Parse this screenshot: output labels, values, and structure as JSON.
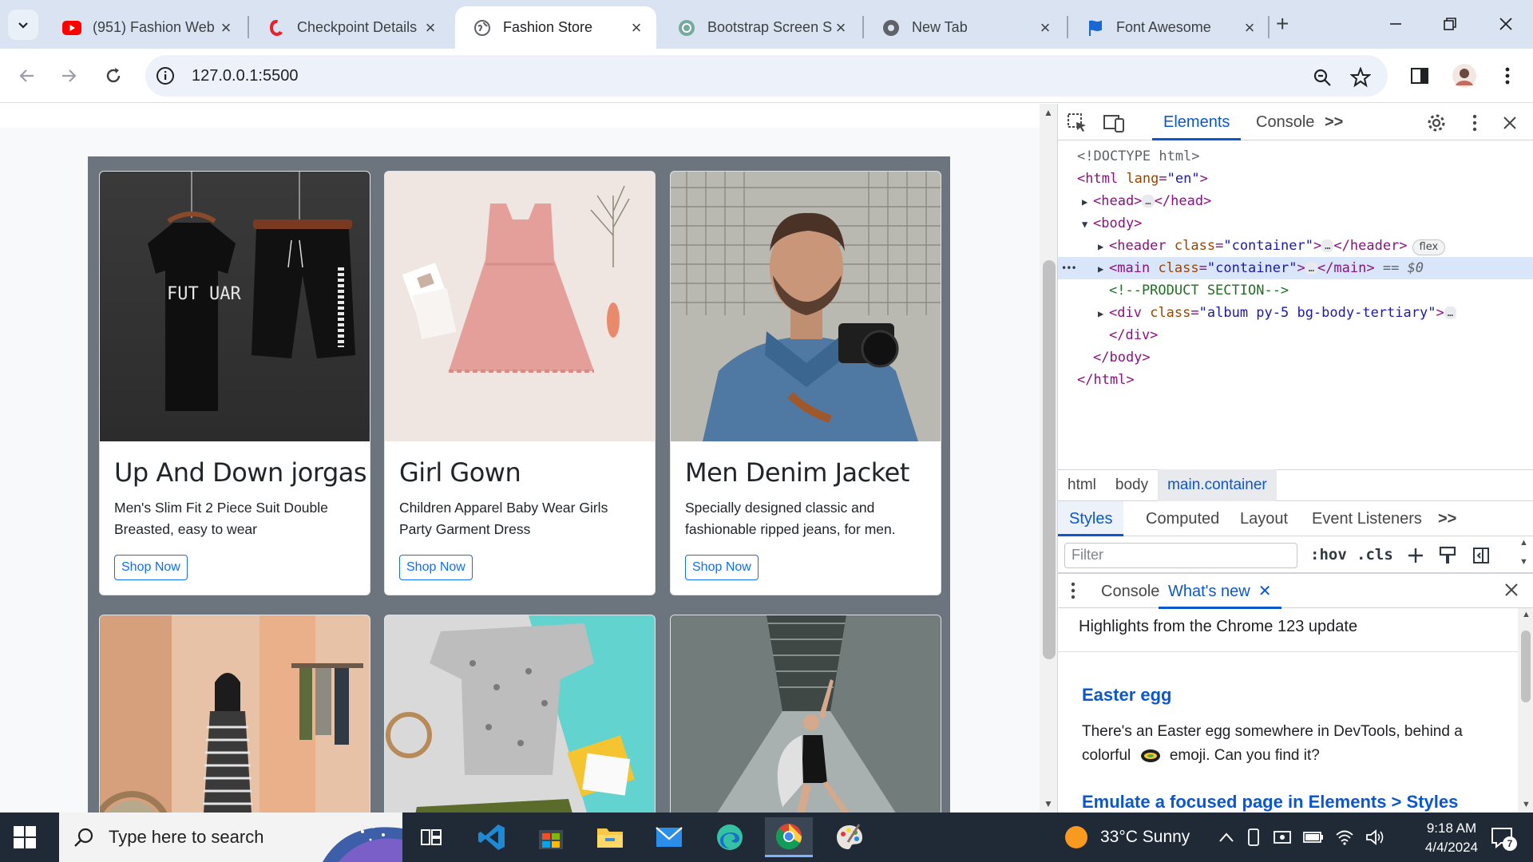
{
  "browser": {
    "tabs": [
      {
        "title": "(951) Fashion Web",
        "icon": "youtube-icon",
        "active": false
      },
      {
        "title": "Checkpoint Details",
        "icon": "checkpoint-icon",
        "active": false
      },
      {
        "title": "Fashion Store",
        "icon": "globe-icon",
        "active": true
      },
      {
        "title": "Bootstrap Screen S",
        "icon": "chatgpt-icon",
        "active": false
      },
      {
        "title": "New Tab",
        "icon": "chrome-icon",
        "active": false
      },
      {
        "title": "Font Awesome",
        "icon": "font-awesome-flag-icon",
        "active": false
      }
    ],
    "new_tab_label": "+",
    "url": "127.0.0.1:5500",
    "colors": {
      "tabstrip": "#dae3f1",
      "omnibox": "#edf2fa"
    }
  },
  "page": {
    "cards": [
      {
        "title": "Up And Down jorgas",
        "description": "Men's Slim Fit 2 Piece Suit Double Breasted, easy to wear",
        "button": "Shop Now",
        "image": "tshirt-shorts-image"
      },
      {
        "title": "Girl Gown",
        "description": "Children Apparel Baby Wear Girls Party Garment Dress",
        "button": "Shop Now",
        "image": "pink-dress-image"
      },
      {
        "title": "Men Denim Jacket",
        "description": "Specially designed classic and fashionable ripped jeans, for men.",
        "button": "Shop Now",
        "image": "man-camera-image"
      },
      {
        "title": "",
        "description": "",
        "button": "",
        "image": "woman-striped-dress-image"
      },
      {
        "title": "",
        "description": "",
        "button": "",
        "image": "baby-clothes-flatlay-image"
      },
      {
        "title": "",
        "description": "",
        "button": "",
        "image": "dancer-corridor-image"
      }
    ],
    "print_on_shirt": "FUT UAR",
    "colors": {
      "album_bg": "#6c757d",
      "button": "#0d6efd"
    }
  },
  "devtools": {
    "tabs": [
      "Elements",
      "Console"
    ],
    "more_tabs": ">>",
    "dom": {
      "doctype": "<!DOCTYPE html>",
      "html_open_tag": "<html",
      "html_attr": "lang",
      "html_val": "\"en\"",
      "head_open": "<head>",
      "head_close": "</head>",
      "body_open": "<body>",
      "header_open": "<header",
      "header_attr": "class",
      "header_val": "\"container\"",
      "header_close": "</header>",
      "flex_badge": "flex",
      "main_open": "<main",
      "main_attr": "class",
      "main_val": "\"container\"",
      "main_close": "</main>",
      "main_eq": "== $0",
      "comment": "<!--PRODUCT SECTION-->",
      "div_open": "<div",
      "div_attr": "class",
      "div_val": "\"album py-5 bg-body-tertiary\"",
      "div_close": "</div>",
      "body_close": "</body>",
      "html_close": "</html>",
      "gt": ">",
      "eq": "=",
      "ellipsis": "…",
      "row_dots": "•••"
    },
    "breadcrumbs": [
      "html",
      "body",
      "main.container"
    ],
    "subtabs": [
      "Styles",
      "Computed",
      "Layout",
      "Event Listeners"
    ],
    "filter_placeholder": "Filter",
    "hov_label": ":hov",
    "cls_label": ".cls",
    "drawer_tabs": [
      "Console",
      "What's new"
    ],
    "whats_new": {
      "heading": "Highlights from the Chrome 123 update",
      "item1_title": "Easter egg",
      "item1_text_a": "There's an Easter egg somewhere in DevTools, behind a",
      "item1_text_b": "colorful",
      "item1_text_c": "emoji. Can you find it?",
      "item2_title": "Emulate a focused page in Elements > Styles"
    }
  },
  "taskbar": {
    "search_placeholder": "Type here to search",
    "weather": "33°C  Sunny",
    "time": "9:18 AM",
    "date": "4/4/2024",
    "notification_count": "7"
  }
}
